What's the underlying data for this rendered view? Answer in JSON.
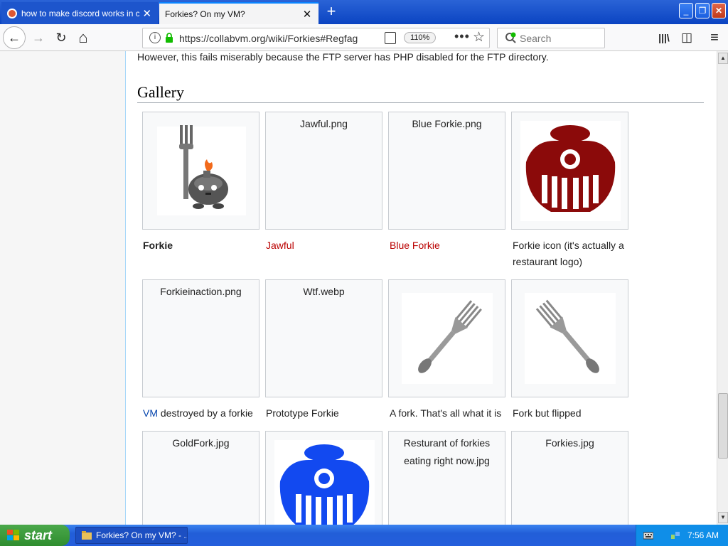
{
  "tabs": [
    {
      "title": "how to make discord works in cvm",
      "close": "✕",
      "active": false
    },
    {
      "title": "Forkies? On my VM?",
      "close": "✕",
      "active": true
    }
  ],
  "newtab": "+",
  "window": {
    "minimize": "_",
    "maximize": "❐",
    "close": "✕"
  },
  "nav": {
    "back": "←",
    "forward": "→",
    "reload": "↻",
    "home": "⌂",
    "url": "https://collabvm.org/wiki/Forkies#Regfag",
    "zoom": "110%",
    "more": "•••",
    "star": "☆",
    "search_placeholder": "Search",
    "library": "|||\\",
    "sidebar": "◫",
    "menu": "≡"
  },
  "article": {
    "intro": "However, this fails miserably because the FTP server has PHP disabled for the FTP directory.",
    "heading": "Gallery",
    "gallery": [
      {
        "file": "",
        "caption": "Forkie",
        "image": "forkie-character"
      },
      {
        "file": "Jawful.png",
        "caption": "Jawful",
        "image": ""
      },
      {
        "file": "Blue Forkie.png",
        "caption": "Blue Forkie",
        "image": ""
      },
      {
        "file": "",
        "caption": "Forkie icon (it's actually a restaurant logo)",
        "image": "red-logo"
      },
      {
        "file": "Forkieinaction.png",
        "caption_link": "VM",
        "caption": " destroyed by a forkie",
        "image": ""
      },
      {
        "file": "Wtf.webp",
        "caption": "Prototype Forkie",
        "image": ""
      },
      {
        "file": "",
        "caption": "A fork. That's all what it is",
        "image": "fork"
      },
      {
        "file": "",
        "caption": "Fork but flipped",
        "image": "fork-flipped"
      },
      {
        "file": "GoldFork.jpg",
        "caption": "",
        "image": ""
      },
      {
        "file": "",
        "caption": "",
        "image": "blue-logo"
      },
      {
        "file": "Resturant of forkies eating right now.jpg",
        "caption": "",
        "image": ""
      },
      {
        "file": "Forkies.jpg",
        "caption": "",
        "image": ""
      }
    ]
  },
  "colors": {
    "redlink": "#ba0000",
    "link": "#0645ad",
    "logo_red": "#8b0a0a",
    "logo_blue": "#1249f0"
  },
  "taskbar": {
    "start": "start",
    "item": "Forkies? On my VM? - ...",
    "clock": "7:56 AM"
  }
}
